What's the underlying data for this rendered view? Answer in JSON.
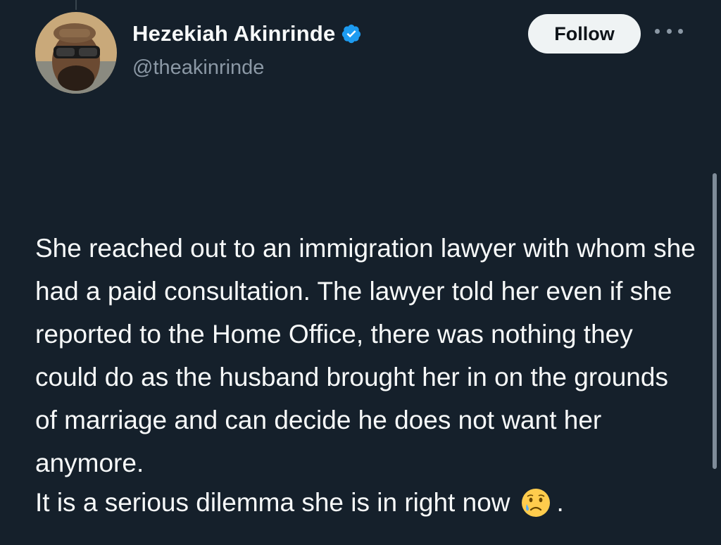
{
  "author": {
    "display_name": "Hezekiah Akinrinde",
    "handle": "@theakinrinde",
    "verified": true,
    "avatar_icon": "profile-avatar"
  },
  "actions": {
    "follow_label": "Follow",
    "more_icon": "more-horizontal-icon"
  },
  "tweet": {
    "paragraph_1": "She reached out to an immigration lawyer with whom she had a paid consultation. The lawyer told her even if she reported to the Home Office, there was nothing they could do as the husband brought her in on the grounds of marriage and can decide he does not want her anymore.",
    "paragraph_2_text": "It is a serious dilemma she is in right now",
    "paragraph_2_emoji": "crying-face-icon",
    "paragraph_2_end": "."
  },
  "colors": {
    "background": "#15202b",
    "text": "#f7f9f9",
    "secondary_text": "#8b98a5",
    "verified_badge": "#1d9bf0",
    "follow_button_bg": "#eff3f4"
  }
}
